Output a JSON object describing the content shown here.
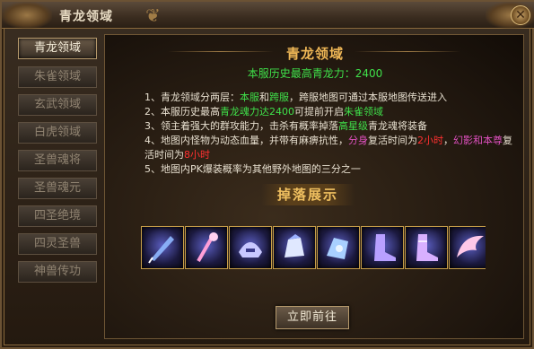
{
  "window": {
    "title": "青龙领域",
    "close_label": "✕"
  },
  "sidebar": {
    "items": [
      {
        "label": "青龙领域",
        "active": true
      },
      {
        "label": "朱雀领域",
        "active": false
      },
      {
        "label": "玄武领域",
        "active": false
      },
      {
        "label": "白虎领域",
        "active": false
      },
      {
        "label": "圣兽魂将",
        "active": false
      },
      {
        "label": "圣兽魂元",
        "active": false
      },
      {
        "label": "四圣绝境",
        "active": false
      },
      {
        "label": "四灵圣兽",
        "active": false
      },
      {
        "label": "神兽传功",
        "active": false
      }
    ]
  },
  "main": {
    "section_title": "青龙领域",
    "subtitle": "本服历史最高青龙力：2400",
    "rules": {
      "r1_a": "1、青龙领域分两层：",
      "r1_b": "本服",
      "r1_c": "和",
      "r1_d": "跨服",
      "r1_e": "，跨服地图可通过本服地图传送进入",
      "r2_a": "2、本服历史最高",
      "r2_b": "青龙魂力达2400",
      "r2_c": "可提前开启",
      "r2_d": "朱雀领域",
      "r3_a": "3、领主着强大的群攻能力，击杀有概率掉落",
      "r3_b": "高星级",
      "r3_c": "青龙魂将装备",
      "r4_a": "4、地图内怪物为动态血量，并带有麻痹抗性，",
      "r4_b": "分身",
      "r4_c": "复活时间为",
      "r4_d": "2小时",
      "r4_e": "，",
      "r4_f": "幻影和本尊",
      "r4_g": "复活时间为",
      "r4_h": "8小时",
      "r5": "5、地图内PK爆装概率为其他野外地图的三分之一"
    },
    "drop_title": "掉落展示",
    "drop_items": [
      {
        "icon": "sword-icon",
        "color": "#8fb8ff"
      },
      {
        "icon": "staff-icon",
        "color": "#ff9fd8"
      },
      {
        "icon": "helmet-icon",
        "color": "#c8c8ff"
      },
      {
        "icon": "gauntlet-icon",
        "color": "#e0e8ff"
      },
      {
        "icon": "gauntlet-icon",
        "color": "#a8d0ff"
      },
      {
        "icon": "boot-icon",
        "color": "#b8a0ff"
      },
      {
        "icon": "boot-icon",
        "color": "#d8b0ff"
      },
      {
        "icon": "wing-icon",
        "color": "#ffc8e8"
      }
    ],
    "go_button": "立即前往"
  },
  "colors": {
    "accent_gold": "#f0b856",
    "highlight_green": "#3fe04a",
    "highlight_pink": "#e050c0",
    "highlight_red": "#ff3030"
  }
}
